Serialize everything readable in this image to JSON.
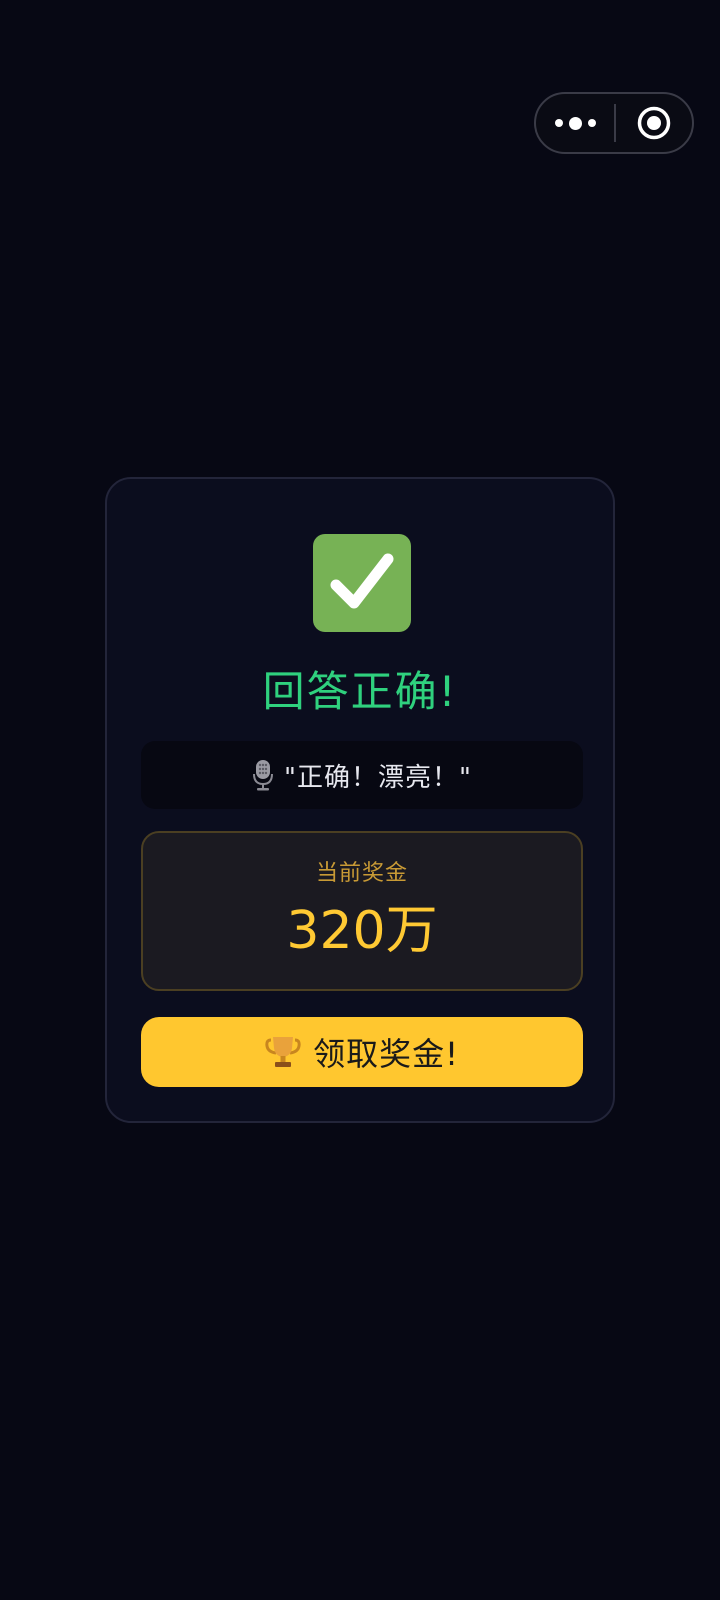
{
  "capsule": {
    "more_icon": "more-dots-icon",
    "close_icon": "target-close-icon"
  },
  "result": {
    "icon": "check-mark-icon",
    "icon_color": "#77b255",
    "title": "回答正确!",
    "title_color": "#2fd17e"
  },
  "host_quote": {
    "icon": "microphone-icon",
    "text": "\"正确！漂亮！\""
  },
  "prize": {
    "label": "当前奖金",
    "value": "320万",
    "accent_color": "#ffc933"
  },
  "claim_button": {
    "icon": "trophy-icon",
    "label": "领取奖金!",
    "background_color": "#ffc72f"
  }
}
